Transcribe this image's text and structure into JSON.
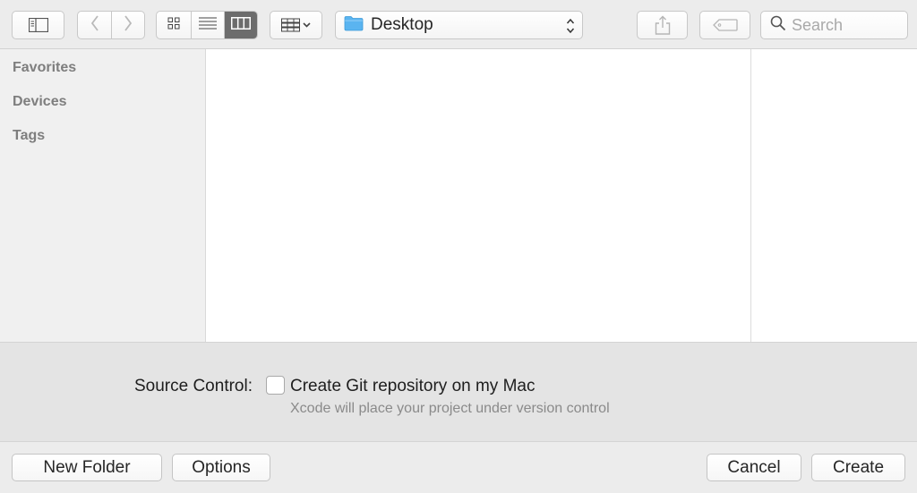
{
  "toolbar": {
    "icons": {
      "sidebar_toggle": "sidebar-icon",
      "back": "chevron-left-icon",
      "forward": "chevron-right-icon",
      "icon_view": "grid-icon",
      "list_view": "list-icon",
      "column_view": "columns-icon",
      "arrange": "arrange-icon",
      "share": "share-icon",
      "tag": "tag-icon",
      "search": "search-icon"
    },
    "active_view": "columns",
    "location": "Desktop",
    "search_placeholder": "Search"
  },
  "sidebar": {
    "sections": [
      "Favorites",
      "Devices",
      "Tags"
    ]
  },
  "accessory": {
    "source_control_label": "Source Control:",
    "checkbox_label": "Create Git repository on my Mac",
    "checkbox_checked": false,
    "hint": "Xcode will place your project under version control"
  },
  "buttons": {
    "new_folder": "New Folder",
    "options": "Options",
    "cancel": "Cancel",
    "create": "Create"
  },
  "colors": {
    "folder": "#5ab4f0",
    "active_segment": "#6c6c6c",
    "window_bg": "#ececec"
  }
}
